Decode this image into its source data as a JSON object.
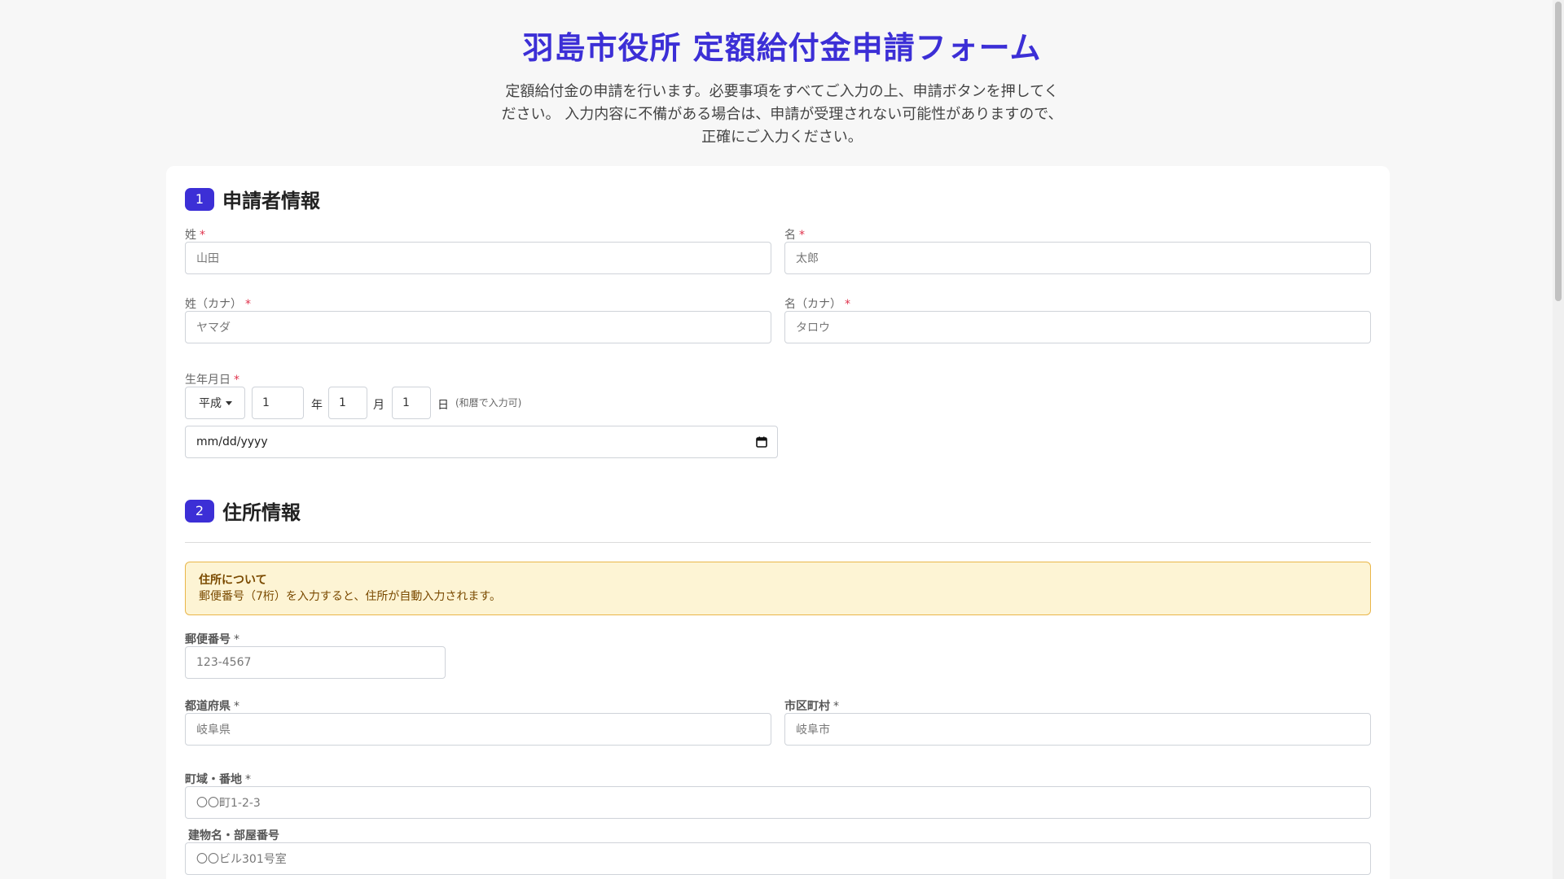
{
  "header": {
    "title": "羽島市役所 定額給付金申請フォーム",
    "intro": "定額給付金の申請を行います。必要事項をすべてご入力の上、申請ボタンを押してください。 入力内容に不備がある場合は、申請が受理されない可能性がありますので、正確にご入力ください。"
  },
  "section1": {
    "number": "1",
    "title": "申請者情報",
    "last_name": {
      "label": "姓",
      "required": "*",
      "placeholder": "山田"
    },
    "first_name": {
      "label": "名",
      "required": "*",
      "placeholder": "太郎"
    },
    "last_kana": {
      "label": "姓（カナ）",
      "required": "*",
      "placeholder": "ヤマダ"
    },
    "first_kana": {
      "label": "名（カナ）",
      "required": "*",
      "placeholder": "タロウ"
    },
    "birthdate": {
      "label": "生年月日",
      "required": "*",
      "era": "平成",
      "year": "1",
      "year_unit": "年",
      "month": "1",
      "month_unit": "月",
      "day": "1",
      "day_unit": "日",
      "hint": "(和暦で入力可)",
      "date_placeholder": "mm/dd/yyyy"
    }
  },
  "section2": {
    "number": "2",
    "title": "住所情報",
    "notice": {
      "title": "住所について",
      "text": "郵便番号（7桁）を入力すると、住所が自動入力されます。"
    },
    "postal": {
      "label": "郵便番号",
      "required": "*",
      "placeholder": "123-4567"
    },
    "prefecture": {
      "label": "都道府県",
      "required": "*",
      "placeholder": "岐阜県"
    },
    "city": {
      "label": "市区町村",
      "required": "*",
      "placeholder": "岐阜市"
    },
    "street": {
      "label": "町域・番地",
      "required": "*",
      "placeholder": "〇〇町1-2-3"
    },
    "building": {
      "label": "建物名・部屋番号",
      "placeholder": "〇〇ビル301号室"
    }
  },
  "icons": {
    "calendar": "calendar-icon",
    "dropdown": "caret-down-icon"
  },
  "colors": {
    "accent": "#3c2fd6",
    "required": "#e0334d",
    "notice_bg": "#fdf4d4",
    "notice_border": "#e9b64a"
  }
}
